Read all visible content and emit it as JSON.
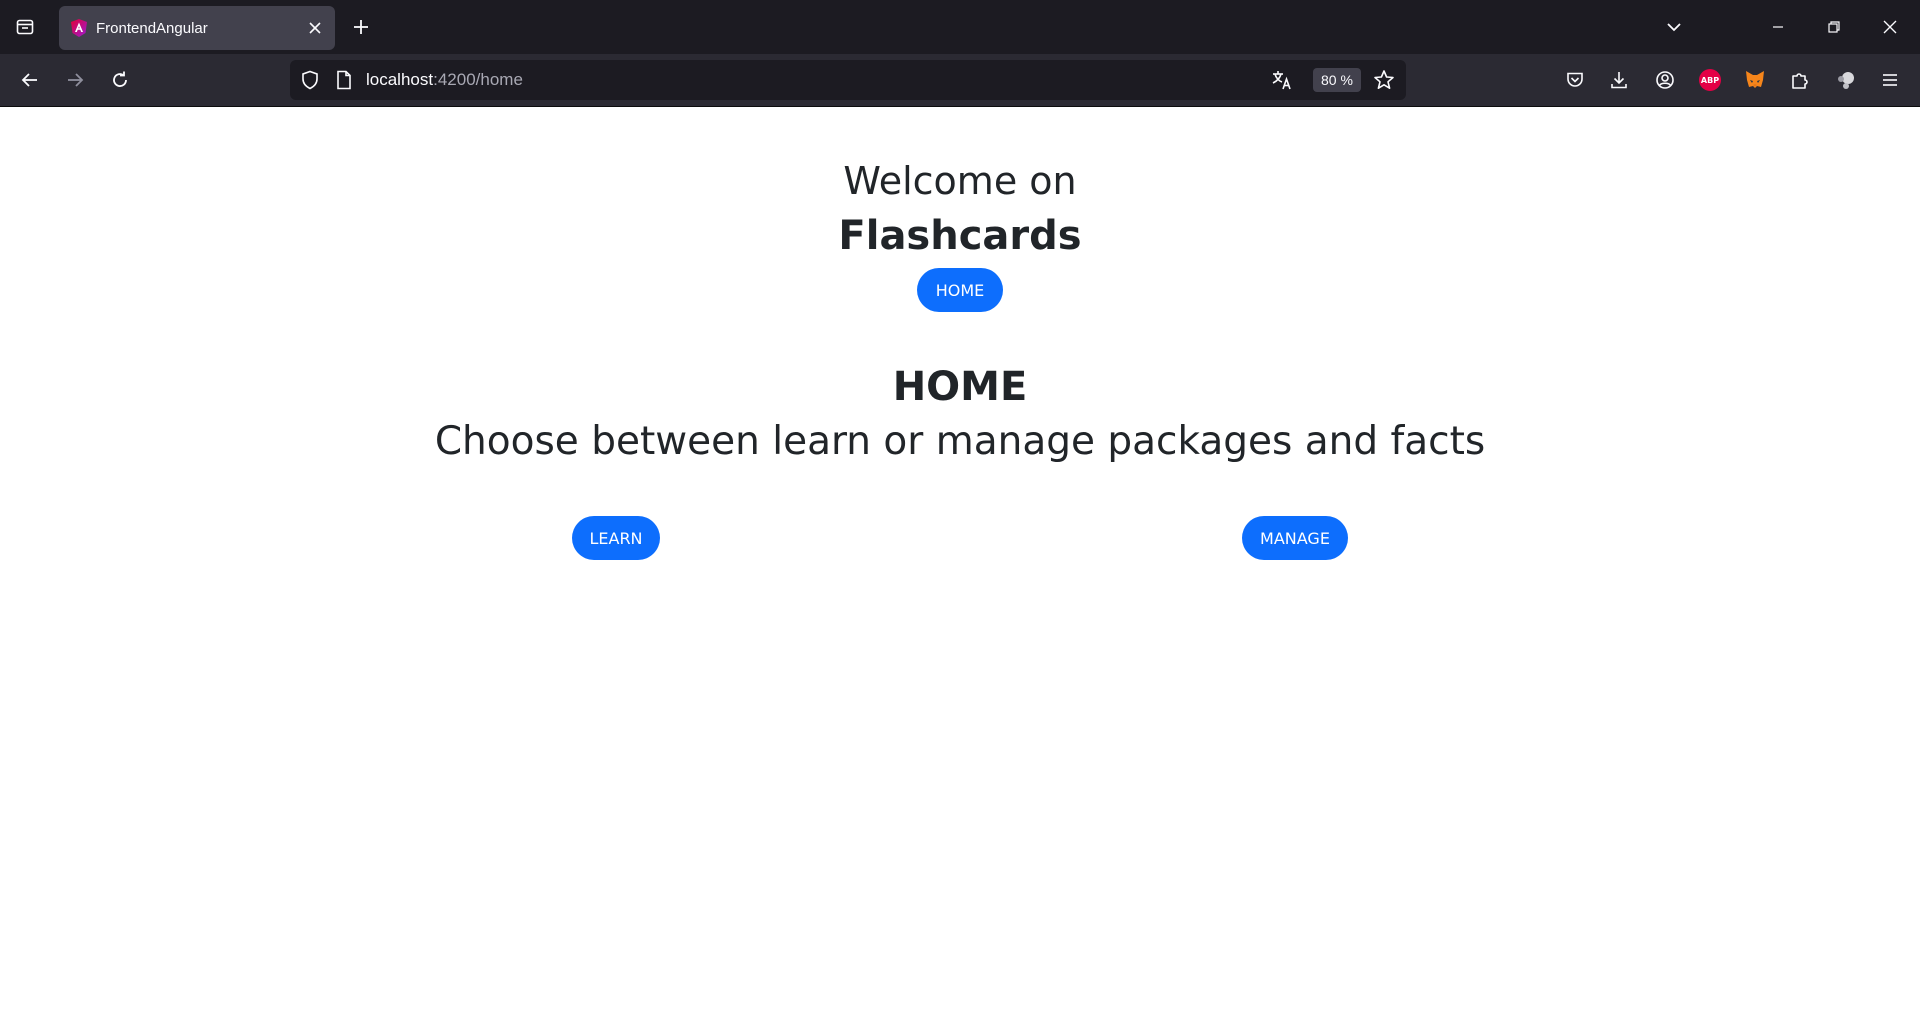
{
  "browser": {
    "tab": {
      "title": "FrontendAngular"
    },
    "url": {
      "host": "localhost",
      "path": ":4200/home"
    },
    "zoom": "80 %"
  },
  "page": {
    "welcome": "Welcome on",
    "brand": "Flashcards",
    "nav_home_label": "HOME",
    "section_title": "HOME",
    "section_subtitle": "Choose between learn or manage packages and facts",
    "learn_label": "LEARN",
    "manage_label": "MANAGE"
  },
  "colors": {
    "primary": "#0d6efd",
    "chrome_dark": "#1c1b22",
    "chrome_toolbar": "#2b2a33"
  }
}
